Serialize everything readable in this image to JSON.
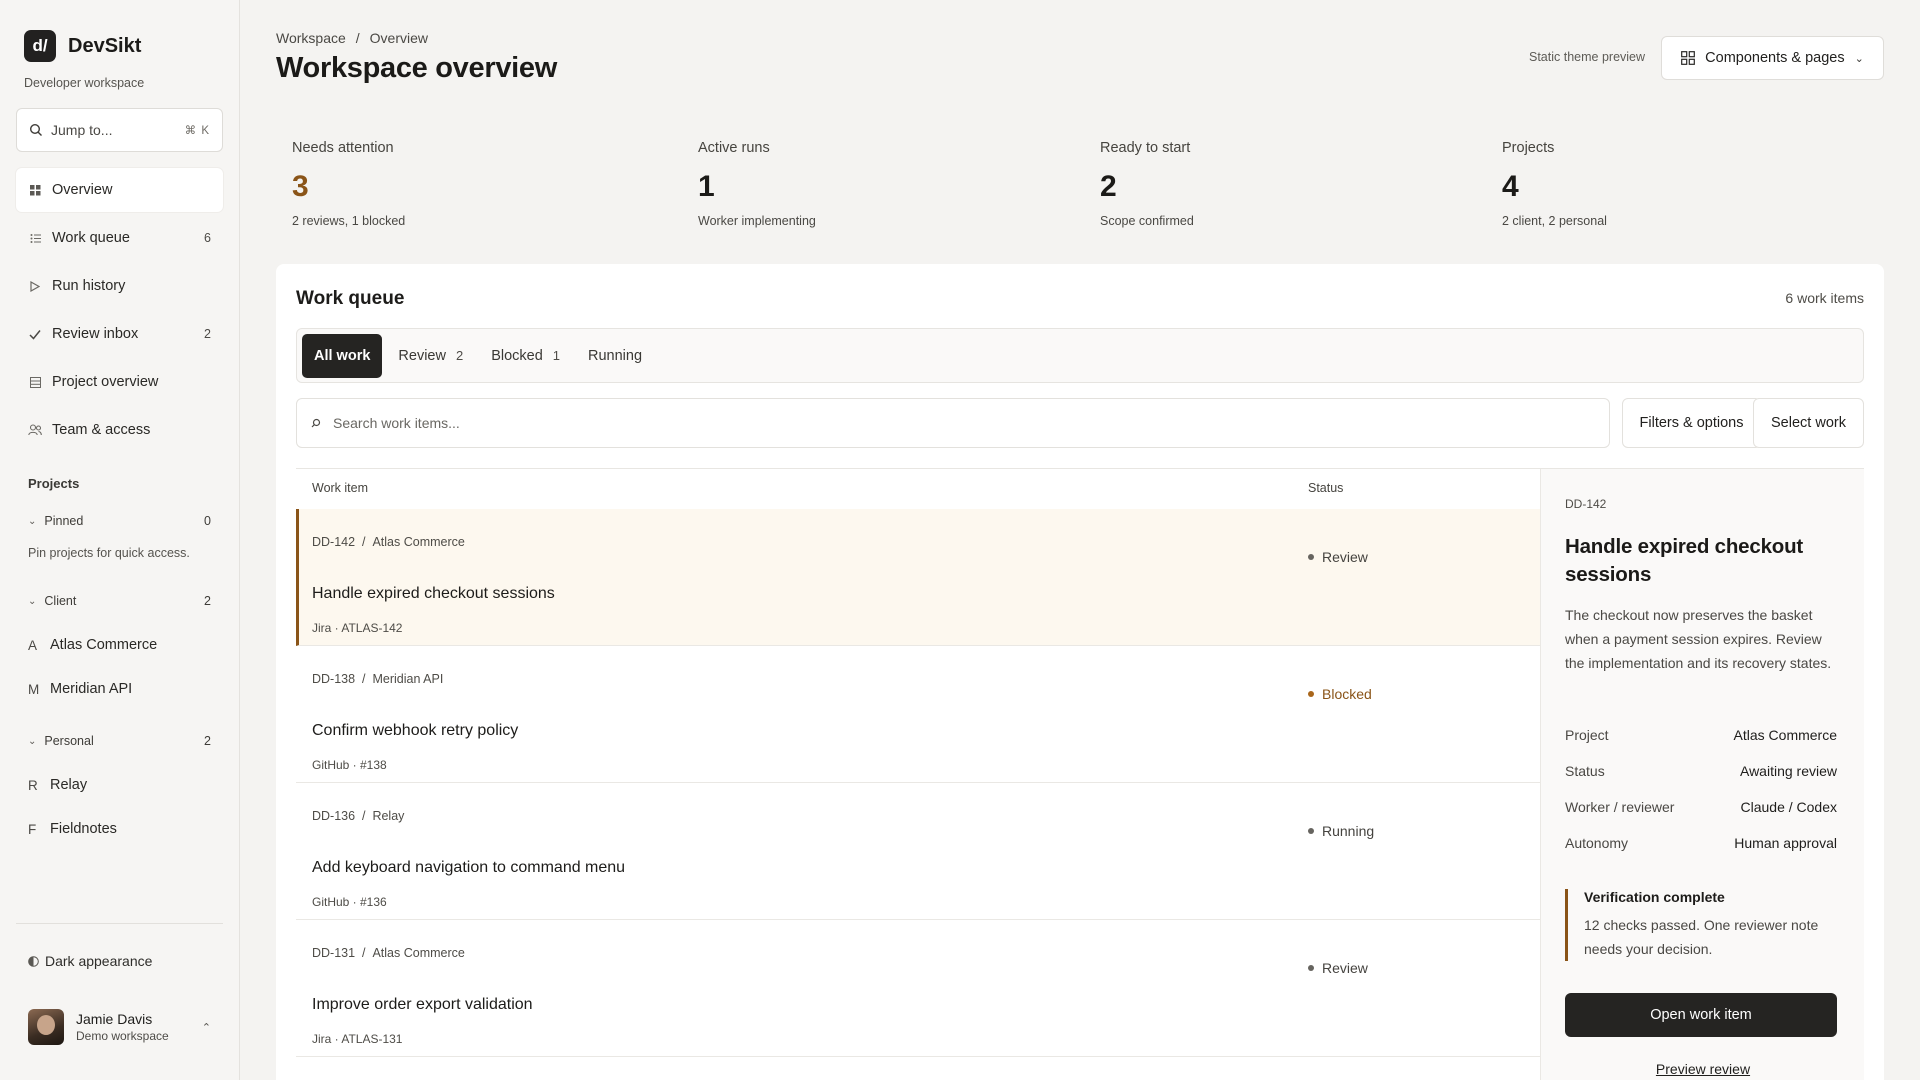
{
  "sidebar": {
    "logo_text": "d/",
    "app_name": "DevSikt",
    "subtitle": "Developer workspace",
    "jump_placeholder": "Jump to...",
    "jump_shortcut": "⌘ K",
    "nav": [
      {
        "label": "Overview",
        "icon": "grid-icon",
        "count": ""
      },
      {
        "label": "Work queue",
        "icon": "list-icon",
        "count": "6"
      },
      {
        "label": "Run history",
        "icon": "play-icon",
        "count": ""
      },
      {
        "label": "Review inbox",
        "icon": "check-icon",
        "count": "2"
      },
      {
        "label": "Project overview",
        "icon": "table-icon",
        "count": ""
      },
      {
        "label": "Team & access",
        "icon": "people-icon",
        "count": ""
      }
    ],
    "projects_heading": "Projects",
    "groups": {
      "pinned": {
        "label": "Pinned",
        "count": "0",
        "hint": "Pin projects for quick access."
      },
      "client": {
        "label": "Client",
        "count": "2",
        "items": [
          {
            "letter": "A",
            "name": "Atlas Commerce"
          },
          {
            "letter": "M",
            "name": "Meridian API"
          }
        ]
      },
      "personal": {
        "label": "Personal",
        "count": "2",
        "items": [
          {
            "letter": "R",
            "name": "Relay"
          },
          {
            "letter": "F",
            "name": "Fieldnotes"
          }
        ]
      }
    },
    "dark_toggle": "Dark appearance",
    "user": {
      "name": "Jamie Davis",
      "workspace": "Demo workspace"
    }
  },
  "header": {
    "breadcrumb": [
      "Workspace",
      "/",
      "Overview"
    ],
    "title": "Workspace overview",
    "theme_note": "Static theme preview",
    "components_button": "Components & pages"
  },
  "stats": [
    {
      "label": "Needs attention",
      "value": "3",
      "sub": "2 reviews, 1 blocked",
      "accent": "#8a5418"
    },
    {
      "label": "Active runs",
      "value": "1",
      "sub": "Worker implementing"
    },
    {
      "label": "Ready to start",
      "value": "2",
      "sub": "Scope confirmed"
    },
    {
      "label": "Projects",
      "value": "4",
      "sub": "2 client, 2 personal"
    }
  ],
  "queue": {
    "title": "Work queue",
    "count_text": "6 work items",
    "tabs": [
      {
        "label": "All work",
        "count": ""
      },
      {
        "label": "Review",
        "count": "2"
      },
      {
        "label": "Blocked",
        "count": "1"
      },
      {
        "label": "Running",
        "count": ""
      }
    ],
    "search_placeholder": "Search work items...",
    "filters_button": "Filters & options",
    "select_button": "Select work",
    "columns": [
      "Work item",
      "Status"
    ],
    "rows": [
      {
        "id": "DD-142",
        "project": "Atlas Commerce",
        "title": "Handle expired checkout sessions",
        "source": "Jira · ATLAS-142",
        "status": "Review"
      },
      {
        "id": "DD-138",
        "project": "Meridian API",
        "title": "Confirm webhook retry policy",
        "source": "GitHub · #138",
        "status": "Blocked"
      },
      {
        "id": "DD-136",
        "project": "Relay",
        "title": "Add keyboard navigation to command menu",
        "source": "GitHub · #136",
        "status": "Running"
      },
      {
        "id": "DD-131",
        "project": "Atlas Commerce",
        "title": "Improve order export validation",
        "source": "Jira · ATLAS-131",
        "status": "Review"
      }
    ]
  },
  "detail": {
    "id": "DD-142",
    "title": "Handle expired checkout sessions",
    "description": "The checkout now preserves the basket when a payment session expires. Review the implementation and its recovery states.",
    "fields": [
      {
        "key": "Project",
        "value": "Atlas Commerce"
      },
      {
        "key": "Status",
        "value": "Awaiting review"
      },
      {
        "key": "Worker / reviewer",
        "value": "Claude / Codex"
      },
      {
        "key": "Autonomy",
        "value": "Human approval"
      }
    ],
    "verification_title": "Verification complete",
    "verification_body": "12 checks passed. One reviewer note needs your decision.",
    "open_button": "Open work item",
    "preview_link": "Preview review"
  }
}
